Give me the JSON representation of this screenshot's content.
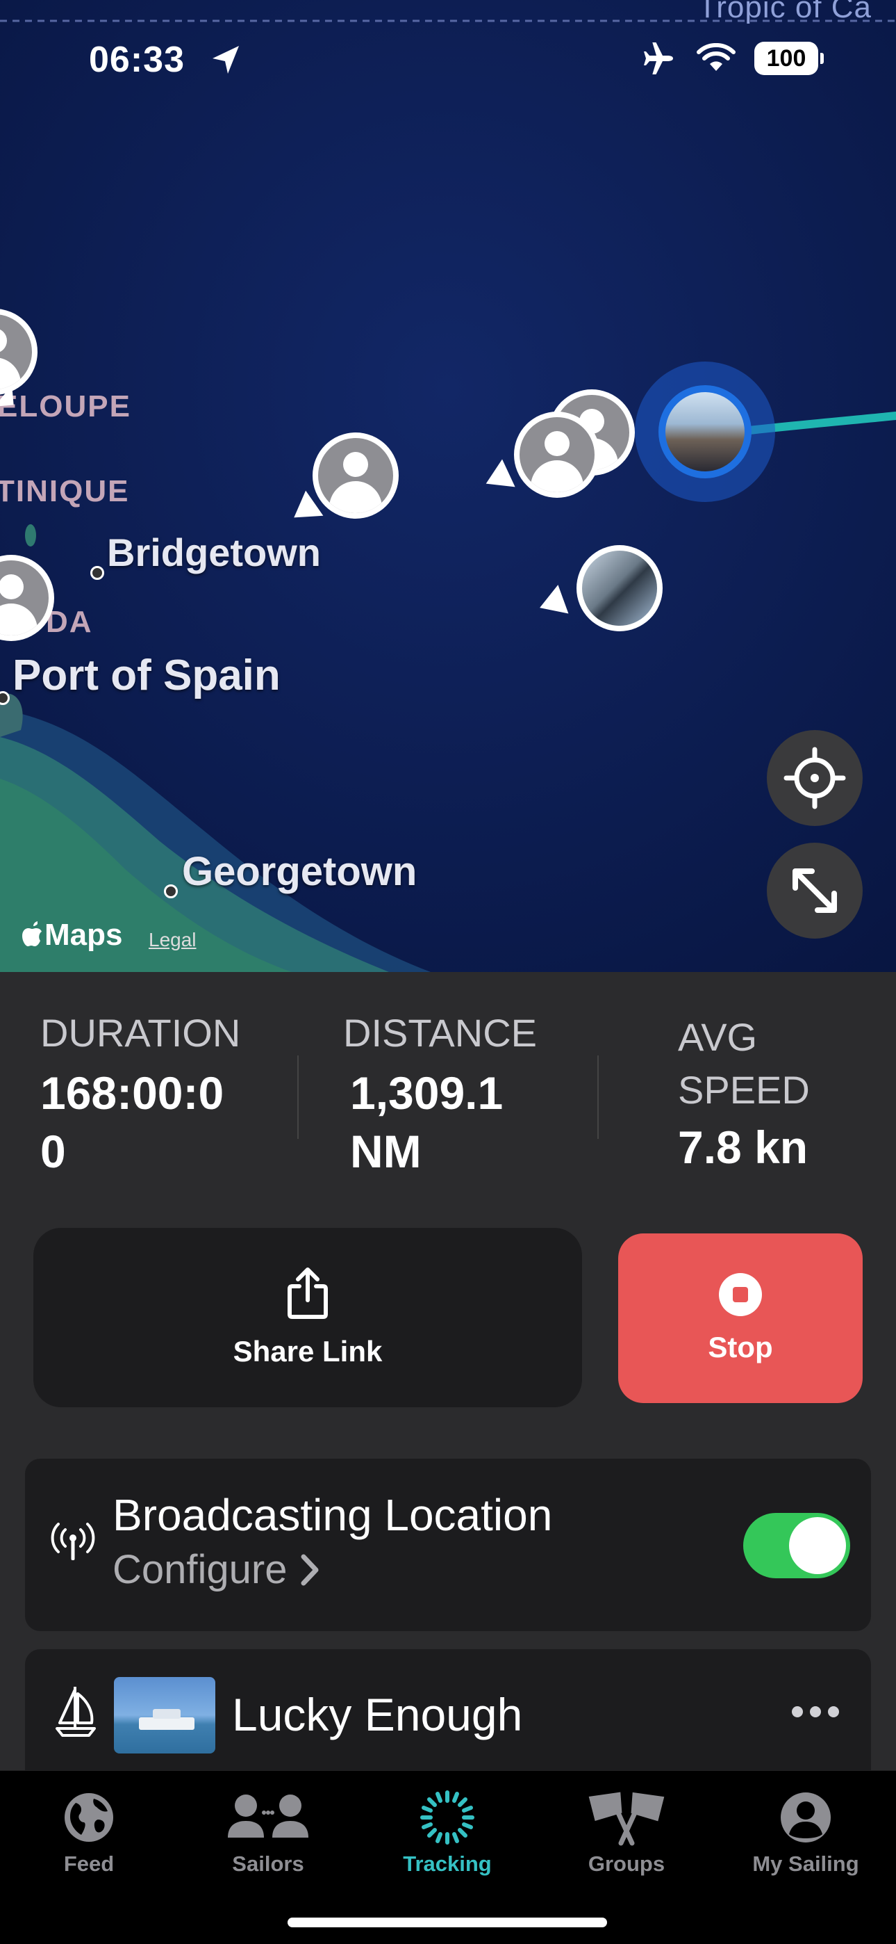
{
  "map": {
    "region_top": "Tropic of Ca",
    "status_time": "06:33",
    "battery": "100",
    "region_labels": [
      "ELOUPE",
      "TINIQUE",
      "DA"
    ],
    "city_labels": {
      "bridgetown": "Bridgetown",
      "port_of_spain": "Port of Spain",
      "georgetown": "Georgetown"
    },
    "attribution": "Maps",
    "legal": "Legal",
    "colors": {
      "track": "#1fb5b0",
      "accent": "#35c1c4"
    }
  },
  "stats": {
    "duration": {
      "label": "DURATION",
      "value_line1": "168:00:0",
      "value_line2": "0"
    },
    "distance": {
      "label": "DISTANCE",
      "value_line1": "1,309.1",
      "value_line2": "NM"
    },
    "avg_speed": {
      "label_line1": "AVG",
      "label_line2": "SPEED",
      "value": "7.8 kn"
    }
  },
  "actions": {
    "share_label": "Share Link",
    "stop_label": "Stop",
    "stop_color": "#e85656"
  },
  "broadcast": {
    "title": "Broadcasting Location",
    "subtitle": "Configure",
    "enabled": true
  },
  "boat": {
    "name": "Lucky Enough"
  },
  "tabs": [
    {
      "label": "Feed",
      "icon": "globe-icon"
    },
    {
      "label": "Sailors",
      "icon": "people-icon"
    },
    {
      "label": "Tracking",
      "icon": "tracking-icon",
      "active": true
    },
    {
      "label": "Groups",
      "icon": "flags-icon"
    },
    {
      "label": "My Sailing",
      "icon": "person-circle-icon"
    }
  ]
}
